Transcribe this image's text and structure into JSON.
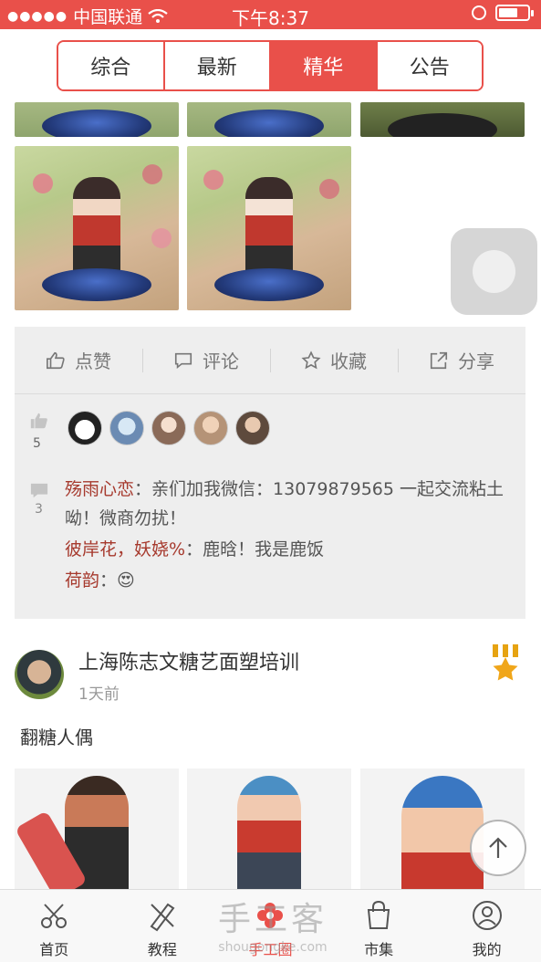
{
  "status_bar": {
    "carrier": "中国联通",
    "time": "下午8:37"
  },
  "tabs": [
    {
      "label": "综合"
    },
    {
      "label": "最新"
    },
    {
      "label": "精华"
    },
    {
      "label": "公告"
    }
  ],
  "actions": [
    {
      "label": "点赞",
      "icon": "thumbs-up-icon"
    },
    {
      "label": "评论",
      "icon": "comment-icon"
    },
    {
      "label": "收藏",
      "icon": "star-icon"
    },
    {
      "label": "分享",
      "icon": "share-icon"
    }
  ],
  "likes": {
    "count": "5"
  },
  "comments": {
    "count": "3",
    "items": [
      {
        "user": "殇雨心恋",
        "text": "：亲们加我微信：13079879565 一起交流粘土呦！微商勿扰！"
      },
      {
        "user": "彼岸花，妖娆%",
        "text": "：鹿晗！我是鹿饭"
      },
      {
        "user": "荷韵",
        "text": "：😍"
      }
    ]
  },
  "post": {
    "author": "上海陈志文糖艺面塑培训",
    "time": "1天前",
    "title": "翻糖人偶"
  },
  "bottom_nav": [
    {
      "label": "首页",
      "icon": "scissors-icon"
    },
    {
      "label": "教程",
      "icon": "ruler-pencil-icon"
    },
    {
      "label": "手工圈",
      "icon": "flower-icon"
    },
    {
      "label": "市集",
      "icon": "shopping-bag-icon"
    },
    {
      "label": "我的",
      "icon": "person-icon"
    }
  ],
  "watermark": {
    "brand": "手工客",
    "domain": "shougongke.com"
  },
  "colors": {
    "accent": "#e9504a",
    "username": "#a6392d"
  }
}
